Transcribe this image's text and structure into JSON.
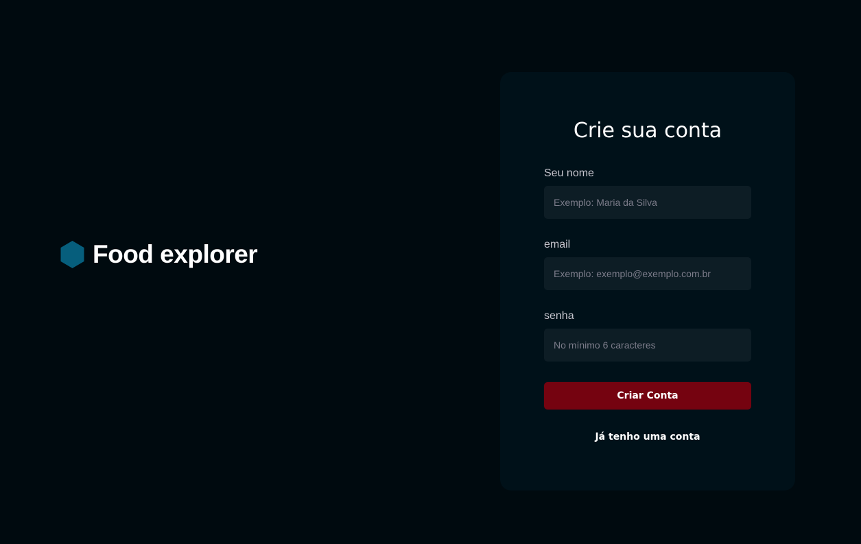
{
  "brand": {
    "name": "Food explorer",
    "icon": "hexagon-logo-icon",
    "icon_color": "#065e7c"
  },
  "form": {
    "title": "Crie sua conta",
    "fields": [
      {
        "label": "Seu nome",
        "placeholder": "Exemplo: Maria da Silva",
        "value": ""
      },
      {
        "label": "email",
        "placeholder": "Exemplo: exemplo@exemplo.com.br",
        "value": ""
      },
      {
        "label": "senha",
        "placeholder": "No mínimo 6 caracteres",
        "value": ""
      }
    ],
    "submit_label": "Criar Conta",
    "login_link": "Já tenho uma conta"
  },
  "colors": {
    "background": "#000a0f",
    "card": "#001119",
    "input": "#0d1d25",
    "button": "#750310",
    "accent": "#065e7c"
  }
}
